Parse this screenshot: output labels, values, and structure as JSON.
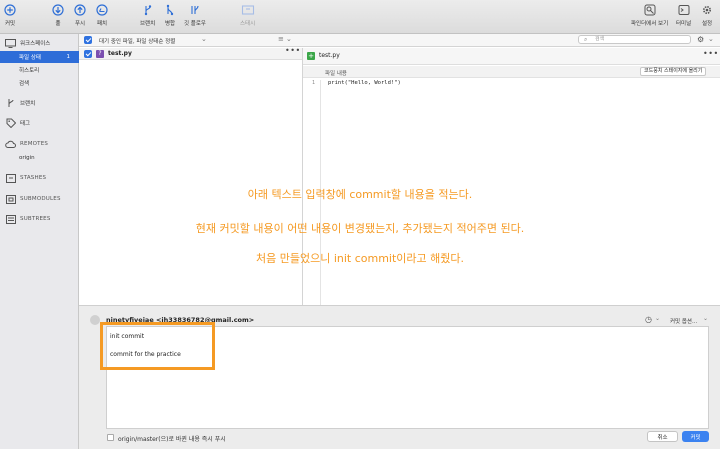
{
  "toolbar": {
    "commit": "커밋",
    "pull": "풀",
    "push": "푸시",
    "fetch": "패치",
    "branch": "브랜치",
    "merge": "병합",
    "git_flow": "깃 플로우",
    "stash": "스태시",
    "show_in_finder": "파인더에서 보기",
    "terminal": "터미널",
    "settings": "설정"
  },
  "sidebar": {
    "workspace": "워크스페이스",
    "file_status": "파일 상태",
    "file_status_count": "1",
    "history": "히스토리",
    "search": "검색",
    "branches": "브랜치",
    "tags": "태그",
    "remotes": "REMOTES",
    "origin": "origin",
    "stashes": "STASHES",
    "submodules": "SUBMODULES",
    "subtrees": "SUBTREES"
  },
  "list_header": {
    "filter": "대기 중인 파일, 파일 상태순 정렬",
    "search_placeholder": "검색"
  },
  "staged_file": {
    "name": "test.py",
    "status_glyph": "?"
  },
  "diff": {
    "file_name": "test.py",
    "hunk_label": "파일 내용",
    "hunk_button": "코드뭉치 스테이지에 올리기",
    "line_number": "1",
    "line_code": "print(\"Hello, World!\")"
  },
  "annotation": {
    "line1": "아래 텍스트 입력창에 commit할 내용을 적는다.",
    "line2": "현재 커밋할 내용이 어떤 내용이 변경됐는지, 추가됐는지 적어주면 된다.",
    "line3": "처음 만들었으니 init commit이라고 해줬다."
  },
  "commit": {
    "author": "ninetyfivejae <jh33836782@gmail.com>",
    "options": "커밋 옵션...",
    "message_line1": "init commit",
    "message_line2": "commit for the practice",
    "push_option": "origin/master(으)로 바뀐 내용 즉시 푸시",
    "cancel": "취소",
    "submit": "커밋"
  },
  "colors": {
    "accent": "#2e6dd8",
    "annotation": "#f59a23",
    "commit_button": "#3b82f0"
  }
}
